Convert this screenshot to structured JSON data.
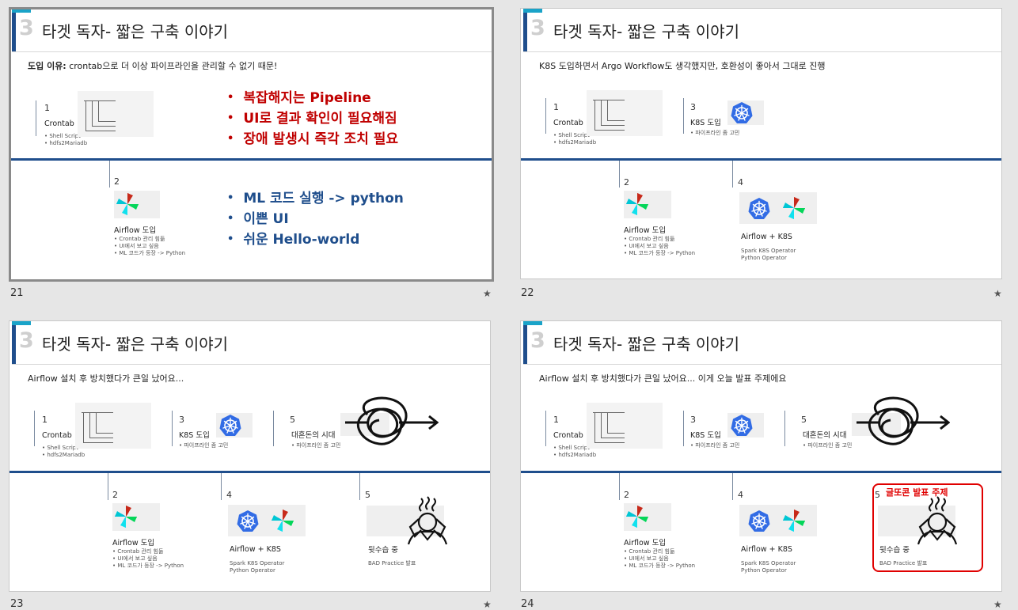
{
  "slides": [
    {
      "id": 21,
      "number_label": "21",
      "section_number": "3",
      "title": "타겟 독자- 짧은 구축 이야기",
      "subtitle_bold": "도입 이유:",
      "subtitle_rest": " crontab으로 더 이상 파이프라인을 관리할 수 없기 때문!",
      "red_bullets": [
        "복잡해지는 Pipeline",
        "UI로 결과 확인이 필요해짐",
        "장애 발생시 즉각 조치 필요"
      ],
      "blue_bullets": [
        "ML 코드 실행 -> python",
        "이쁜 UI",
        "쉬운 Hello-world"
      ],
      "items": {
        "crontab": {
          "num": "1",
          "title": "Crontab",
          "subs": [
            "Shell Script",
            "hdfs2Mariadb"
          ]
        },
        "airflow": {
          "num": "2",
          "title": "Airflow 도입",
          "subs": [
            "Crontab 관리 힘듦",
            "UI에서 보고 싶음",
            "ML 코드가 등장 -> Python"
          ]
        }
      }
    },
    {
      "id": 22,
      "number_label": "22",
      "section_number": "3",
      "title": "타겟 독자- 짧은 구축 이야기",
      "subtitle": "K8S 도입하면서 Argo Workflow도 생각했지만, 호환성이 좋아서 그대로 진행",
      "items": {
        "crontab": {
          "num": "1",
          "title": "Crontab",
          "subs": [
            "Shell Script",
            "hdfs2Mariadb"
          ]
        },
        "k8s": {
          "num": "3",
          "title": "K8S 도입",
          "subs": [
            "파이프라인 좀 고민"
          ]
        },
        "airflow": {
          "num": "2",
          "title": "Airflow 도입",
          "subs": [
            "Crontab 관리 힘듦",
            "UI에서 보고 싶음",
            "ML 코드가 등장 -> Python"
          ]
        },
        "airflow_k8s": {
          "num": "4",
          "title": "Airflow + K8S",
          "subs": [
            "Spark K8S Operator",
            "Python Operator"
          ]
        }
      }
    },
    {
      "id": 23,
      "number_label": "23",
      "section_number": "3",
      "title": "타겟 독자- 짧은 구축 이야기",
      "subtitle": "Airflow 설치 후 방치했다가 큰일 났어요...",
      "items": {
        "crontab": {
          "num": "1",
          "title": "Crontab",
          "subs": [
            "Shell Script",
            "hdfs2Mariadb"
          ]
        },
        "k8s": {
          "num": "3",
          "title": "K8S 도입",
          "subs": [
            "파이프라인 좀 고민"
          ]
        },
        "chaos": {
          "num": "5",
          "title": "대혼돈의 시대",
          "subs": [
            "파이프라인 좀 고민"
          ]
        },
        "airflow": {
          "num": "2",
          "title": "Airflow 도입",
          "subs": [
            "Crontab 관리 힘듦",
            "UI에서 보고 싶음",
            "ML 코드가 등장 -> Python"
          ]
        },
        "airflow_k8s": {
          "num": "4",
          "title": "Airflow + K8S",
          "subs": [
            "Spark K8S Operator",
            "Python Operator"
          ]
        },
        "cleanup": {
          "num": "5",
          "title": "뒷수습 중",
          "subs": [
            "BAD Practice 발표"
          ]
        }
      }
    },
    {
      "id": 24,
      "number_label": "24",
      "section_number": "3",
      "title": "타겟 독자- 짧은 구축 이야기",
      "subtitle": "Airflow 설치 후 방치했다가 큰일 났어요... 이게 오늘 발표 주제에요",
      "callout": "글또콘 발표 주제",
      "items": {
        "crontab": {
          "num": "1",
          "title": "Crontab",
          "subs": [
            "Shell Script",
            "hdfs2Mariadb"
          ]
        },
        "k8s": {
          "num": "3",
          "title": "K8S 도입",
          "subs": [
            "파이프라인 좀 고민"
          ]
        },
        "chaos": {
          "num": "5",
          "title": "대혼돈의 시대",
          "subs": [
            "파이프라인 좀 고민"
          ]
        },
        "airflow": {
          "num": "2",
          "title": "Airflow 도입",
          "subs": [
            "Crontab 관리 힘듦",
            "UI에서 보고 싶음",
            "ML 코드가 등장 -> Python"
          ]
        },
        "airflow_k8s": {
          "num": "4",
          "title": "Airflow + K8S",
          "subs": [
            "Spark K8S Operator",
            "Python Operator"
          ]
        },
        "cleanup": {
          "num": "5",
          "title": "뒷수습 중",
          "subs": [
            "BAD Practice 발표"
          ]
        }
      }
    }
  ],
  "star_glyph": "★",
  "colors": {
    "navy": "#1f4e8c",
    "teal": "#1aa3c8",
    "red": "#c00000",
    "callout_red": "#e00000"
  }
}
